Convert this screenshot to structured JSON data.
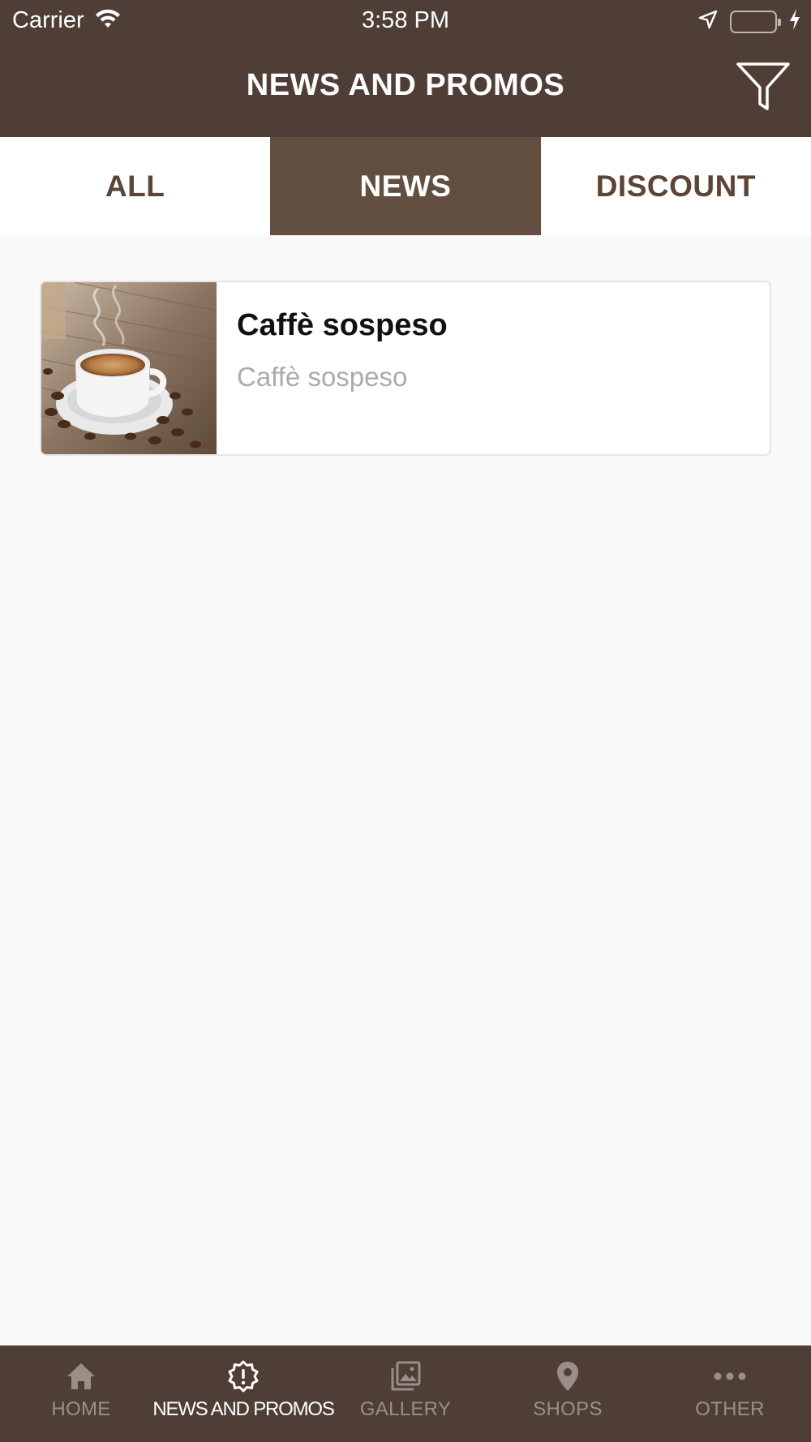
{
  "status_bar": {
    "carrier": "Carrier",
    "time": "3:58 PM",
    "battery_color": "#4cd964"
  },
  "header": {
    "title": "NEWS AND PROMOS",
    "filter_icon": "filter-funnel-icon"
  },
  "tabs": [
    {
      "label": "ALL",
      "active": false
    },
    {
      "label": "NEWS",
      "active": true
    },
    {
      "label": "DISCOUNT",
      "active": false
    }
  ],
  "items": [
    {
      "title": "Caffè sospeso",
      "subtitle": "Caffè sospeso",
      "image": "espresso-cup-coffee-beans"
    }
  ],
  "tab_bar": {
    "items": [
      {
        "label": "HOME",
        "icon": "home-icon",
        "active": false
      },
      {
        "label": "NEWS AND PROMOS",
        "icon": "alert-badge-icon",
        "active": true
      },
      {
        "label": "GALLERY",
        "icon": "gallery-icon",
        "active": false
      },
      {
        "label": "SHOPS",
        "icon": "location-pin-icon",
        "active": false
      },
      {
        "label": "OTHER",
        "icon": "more-dots-icon",
        "active": false
      }
    ]
  },
  "colors": {
    "brand_dark": "#4f3e35",
    "tab_active": "#634f42",
    "tab_text": "#5c4436",
    "inactive_tab_label": "#9a8f88"
  }
}
